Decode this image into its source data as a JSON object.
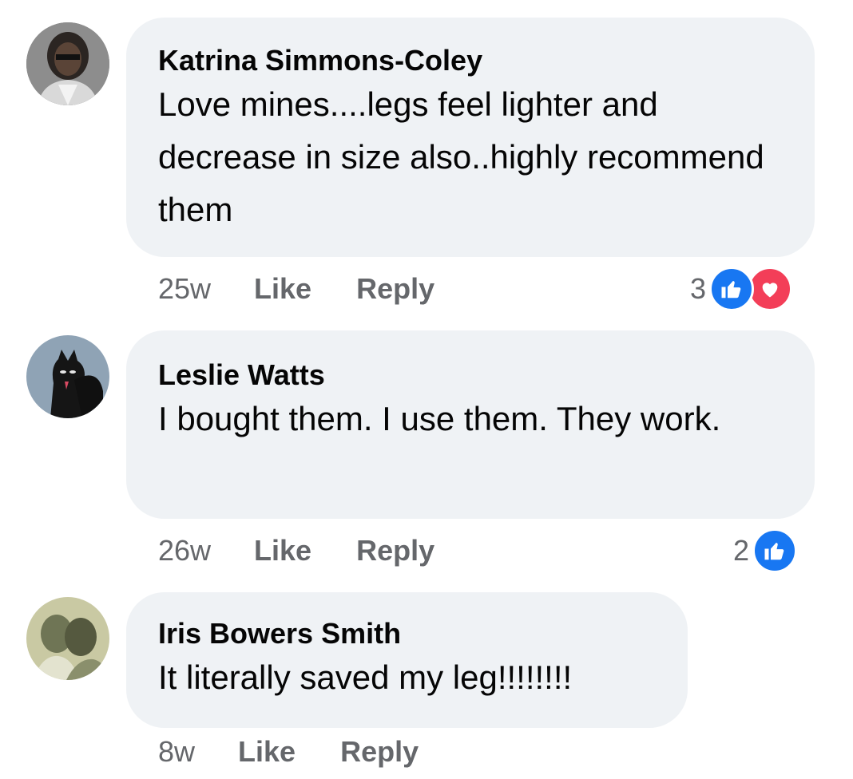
{
  "comments": [
    {
      "author": "Katrina Simmons-Coley",
      "text": "Love mines....legs feel lighter and decrease in size also..highly recommend them",
      "time": "25w",
      "like_label": "Like",
      "reply_label": "Reply",
      "reaction_count": "3",
      "reactions": [
        "like-icon",
        "love-icon"
      ]
    },
    {
      "author": "Leslie Watts",
      "text": "I bought them. I use them. They work.",
      "time": "26w",
      "like_label": "Like",
      "reply_label": "Reply",
      "reaction_count": "2",
      "reactions": [
        "like-icon"
      ]
    },
    {
      "author": "Iris Bowers Smith",
      "text": "It literally saved my leg!!!!!!!!",
      "time": "8w",
      "like_label": "Like",
      "reply_label": "Reply",
      "reaction_count": "",
      "reactions": []
    }
  ],
  "colors": {
    "bubble": "#eff2f5",
    "meta_text": "#65676b",
    "like_blue": "#1877f2",
    "love_red": "#f33e58"
  }
}
